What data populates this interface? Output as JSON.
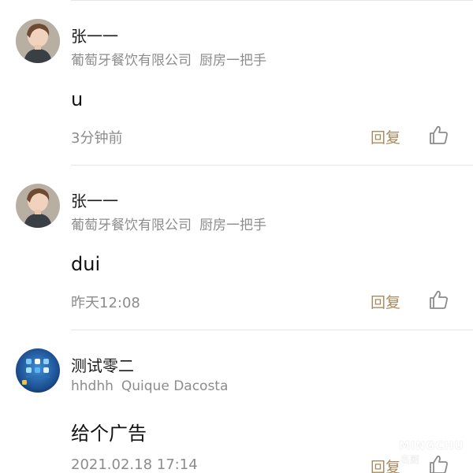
{
  "comments": [
    {
      "name": "张一一",
      "company": "葡萄牙餐饮有限公司",
      "role": "厨房一把手",
      "text": "u",
      "time": "3分钟前",
      "reply_label": "回复",
      "avatar": "portrait-woman"
    },
    {
      "name": "张一一",
      "company": "葡萄牙餐饮有限公司",
      "role": "厨房一把手",
      "text": "dui",
      "time": "昨天12:08",
      "reply_label": "回复",
      "avatar": "portrait-woman"
    },
    {
      "name": "测试零二",
      "company": "hhdhh",
      "role": "Quique Dacosta",
      "text": "给个广告",
      "time": "2021.02.18 17:14",
      "reply_label": "回复",
      "avatar": "phone-homescreen"
    }
  ],
  "watermark": {
    "brand": "MINGCHU",
    "brand_cn": "名厨"
  },
  "colors": {
    "reply": "#a88a5e",
    "secondary_text": "#8c8c8c",
    "divider": "#e6e6e6"
  }
}
